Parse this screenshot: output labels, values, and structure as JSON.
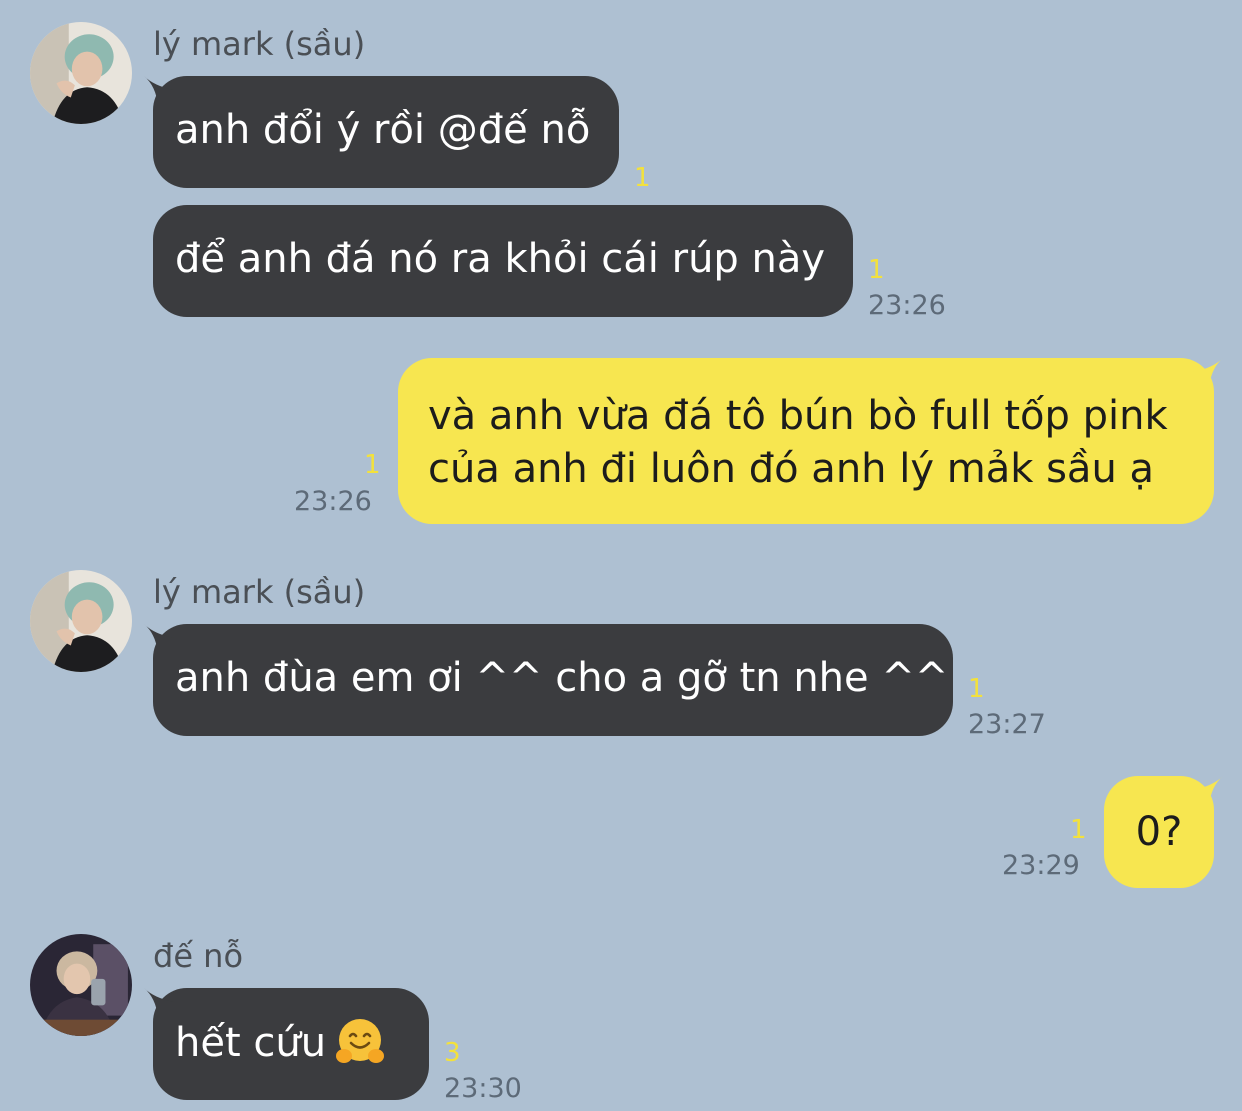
{
  "theme": {
    "background": "#aec0d2",
    "incoming_bubble": "#3b3c3f",
    "outgoing_bubble": "#f7e650",
    "read_count_color": "#f3e13c"
  },
  "messages": [
    {
      "sender": "lý mark (sầu)",
      "avatar_icon": "user-avatar-icon",
      "bubbles": [
        {
          "text": "anh đổi ý rồi @đế nỗ",
          "read_count": "1",
          "time": ""
        },
        {
          "text": "để anh đá nó ra khỏi cái rúp này",
          "read_count": "1",
          "time": "23:26"
        }
      ]
    },
    {
      "sender": "me",
      "bubbles": [
        {
          "line1": "và anh vừa đá tô bún bò full tốp pink",
          "line2": "của anh đi luôn đó anh lý mảk sầu ạ",
          "read_count": "1",
          "time": "23:26"
        }
      ]
    },
    {
      "sender": "lý mark (sầu)",
      "avatar_icon": "user-avatar-icon",
      "bubbles": [
        {
          "text": "anh đùa em ơi ^^ cho a gỡ tn nhe ^^",
          "read_count": "1",
          "time": "23:27"
        }
      ]
    },
    {
      "sender": "me",
      "bubbles": [
        {
          "text": "0?",
          "read_count": "1",
          "time": "23:29"
        }
      ]
    },
    {
      "sender": "đế nỗ",
      "avatar_icon": "user-avatar-icon",
      "bubbles": [
        {
          "text": "hết cứu",
          "emoji": "hugging-face-emoji",
          "read_count": "3",
          "time": "23:30"
        }
      ]
    }
  ]
}
